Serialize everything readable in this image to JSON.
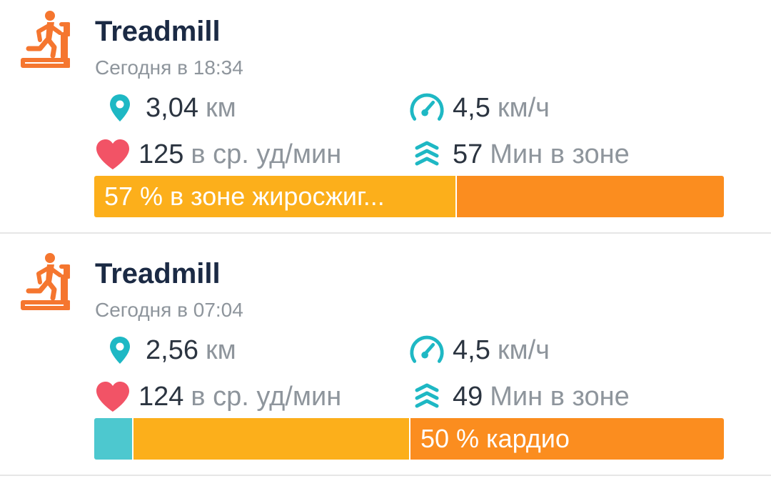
{
  "colors": {
    "activity_icon": "#f5762f",
    "pin": "#1eb8c4",
    "heart": "#f25366",
    "zone_icon": "#1eb8c4",
    "zone_out_of": "#4dc8cf",
    "zone_fat_burn": "#fcaf1b",
    "zone_cardio": "#fb8d1f"
  },
  "activities": [
    {
      "title": "Treadmill",
      "subtitle": "Сегодня в 18:34",
      "distance": {
        "value": "3,04",
        "unit": "км"
      },
      "speed": {
        "value": "4,5",
        "unit": "км/ч"
      },
      "heart_rate": {
        "value": "125",
        "unit": "в ср. уд/мин"
      },
      "zone_minutes": {
        "value": "57",
        "unit": "Мин в зоне"
      },
      "zone_bar": {
        "label": "57 % в зоне жиросжиг...",
        "segments": [
          {
            "zone": "fat_burn",
            "fraction": 0.575
          },
          {
            "zone": "cardio",
            "fraction": 0.425
          }
        ]
      }
    },
    {
      "title": "Treadmill",
      "subtitle": "Сегодня в 07:04",
      "distance": {
        "value": "2,56",
        "unit": "км"
      },
      "speed": {
        "value": "4,5",
        "unit": "км/ч"
      },
      "heart_rate": {
        "value": "124",
        "unit": "в ср. уд/мин"
      },
      "zone_minutes": {
        "value": "49",
        "unit": "Мин в зоне"
      },
      "zone_bar": {
        "label": "50 % кардио",
        "segments": [
          {
            "zone": "out_of",
            "fraction": 0.06
          },
          {
            "zone": "fat_burn",
            "fraction": 0.44
          },
          {
            "zone": "cardio",
            "fraction": 0.5
          }
        ]
      }
    }
  ]
}
